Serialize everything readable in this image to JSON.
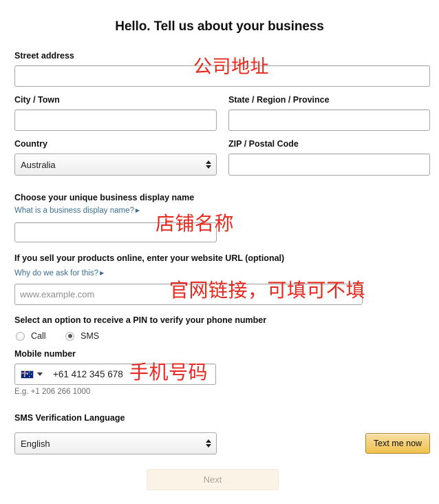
{
  "page": {
    "title": "Hello. Tell us about your business"
  },
  "form": {
    "street_address": {
      "label": "Street address",
      "value": "",
      "placeholder": ""
    },
    "city": {
      "label": "City / Town",
      "value": "",
      "placeholder": ""
    },
    "state": {
      "label": "State / Region / Province",
      "value": "",
      "placeholder": ""
    },
    "country": {
      "label": "Country",
      "selected": "Australia"
    },
    "zip": {
      "label": "ZIP / Postal Code",
      "value": "",
      "placeholder": ""
    },
    "display_name": {
      "label": "Choose your unique business display name",
      "help_link": "What is a business display name?",
      "value": "",
      "placeholder": ""
    },
    "website": {
      "label": "If you sell your products online, enter your website URL (optional)",
      "help_link": "Why do we ask for this?",
      "value": "",
      "placeholder": "www.example.com"
    },
    "pin_option": {
      "label": "Select an option to receive a PIN to verify your phone number",
      "options": [
        {
          "label": "Call",
          "selected": false
        },
        {
          "label": "SMS",
          "selected": true
        }
      ]
    },
    "mobile": {
      "label": "Mobile number",
      "country_flag": "australia-flag-icon",
      "value": "+61 412 345 678",
      "hint": "E.g. +1 206 266 1000"
    },
    "sms_language": {
      "label": "SMS Verification Language",
      "selected": "English"
    }
  },
  "buttons": {
    "text_me_now": "Text me now",
    "next": "Next"
  },
  "annotations": [
    {
      "text": "公司地址"
    },
    {
      "text": "店铺名称"
    },
    {
      "text": "官网链接，可填可不填"
    },
    {
      "text": "手机号码"
    }
  ],
  "colors": {
    "annotation_red": "#e8291f",
    "gold_button": "#f0c14b",
    "link_blue": "#3b6e8f"
  }
}
